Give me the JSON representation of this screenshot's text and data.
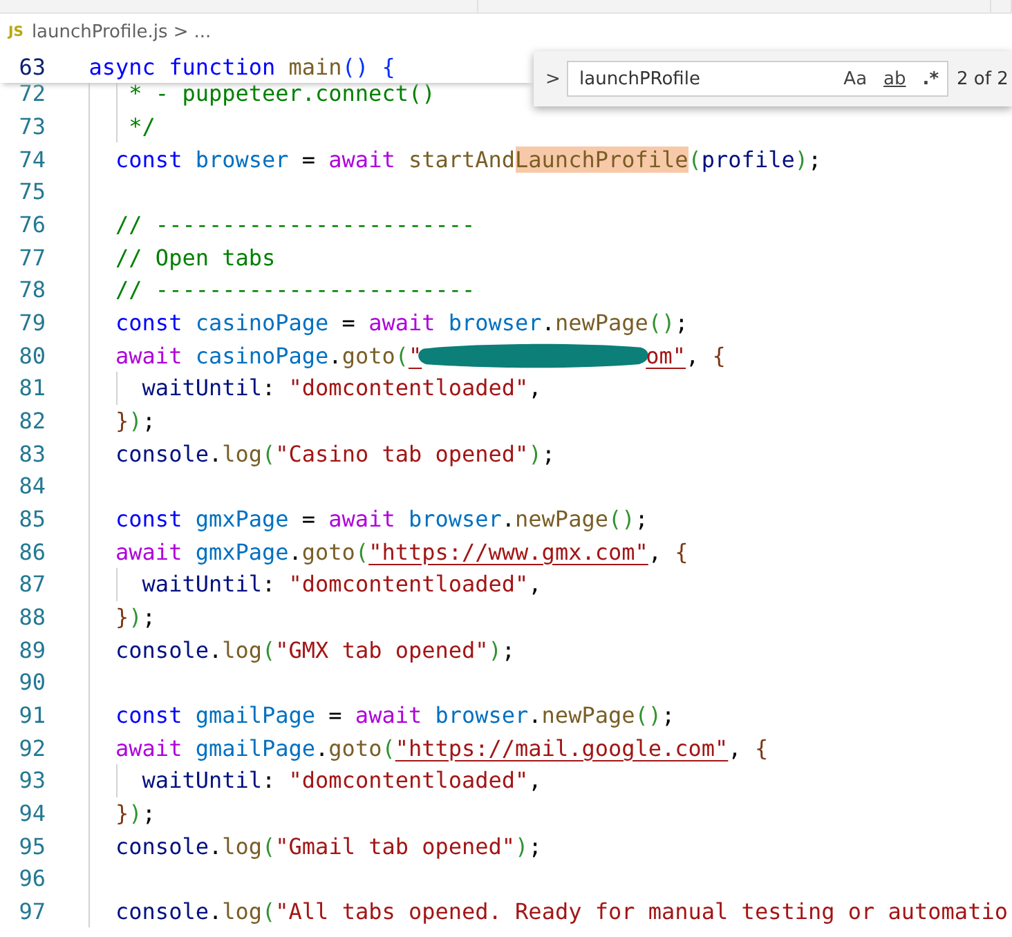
{
  "breadcrumb": {
    "file_badge": "JS",
    "file": "launchProfile.js",
    "separator": ">",
    "rest": "..."
  },
  "sticky_line": {
    "num": "63",
    "tokens": [
      {
        "kind": "kw",
        "text": "  async"
      },
      {
        "kind": "kw",
        "text": " function"
      },
      {
        "kind": "fn",
        "text": " main"
      },
      {
        "kind": "b1",
        "text": "()"
      },
      {
        "kind": "b1",
        "text": " {"
      }
    ]
  },
  "find_widget": {
    "toggle": ">",
    "query": "launchPRofile",
    "options": [
      {
        "label": "Aa",
        "on": false
      },
      {
        "label": "ab",
        "on": false
      },
      {
        "label": ".*",
        "on": false
      }
    ],
    "count": "2 of 2"
  },
  "lines": [
    {
      "num": "72",
      "tokens": [
        {
          "kind": "com",
          "text": "     * - puppeteer.connect()"
        }
      ]
    },
    {
      "num": "73",
      "tokens": [
        {
          "kind": "com",
          "text": "     */"
        }
      ]
    },
    {
      "num": "74",
      "tokens": [
        {
          "kind": "kw",
          "text": "    const"
        },
        {
          "kind": "cvar",
          "text": " browser"
        },
        {
          "kind": "plain",
          "text": " ="
        },
        {
          "kind": "ctrl",
          "text": " await"
        },
        {
          "kind": "fn",
          "text": " startAnd"
        },
        {
          "kind": "match",
          "text": "LaunchProfile"
        },
        {
          "kind": "b2",
          "text": "("
        },
        {
          "kind": "var",
          "text": "profile"
        },
        {
          "kind": "b2",
          "text": ")"
        },
        {
          "kind": "plain",
          "text": ";"
        }
      ]
    },
    {
      "num": "75"
    },
    {
      "num": "76",
      "tokens": [
        {
          "kind": "com",
          "text": "    // ------------------------"
        }
      ]
    },
    {
      "num": "77",
      "tokens": [
        {
          "kind": "com",
          "text": "    // Open tabs"
        }
      ]
    },
    {
      "num": "78",
      "tokens": [
        {
          "kind": "com",
          "text": "    // ------------------------"
        }
      ]
    },
    {
      "num": "79",
      "tokens": [
        {
          "kind": "kw",
          "text": "    const"
        },
        {
          "kind": "cvar",
          "text": " casinoPage"
        },
        {
          "kind": "plain",
          "text": " ="
        },
        {
          "kind": "ctrl",
          "text": " await"
        },
        {
          "kind": "cvar",
          "text": " browser"
        },
        {
          "kind": "plain",
          "text": "."
        },
        {
          "kind": "fn",
          "text": "newPage"
        },
        {
          "kind": "b2",
          "text": "()"
        },
        {
          "kind": "plain",
          "text": ";"
        }
      ]
    },
    {
      "num": "80",
      "tokens": [
        {
          "kind": "ctrl",
          "text": "    await"
        },
        {
          "kind": "cvar",
          "text": " casinoPage"
        },
        {
          "kind": "plain",
          "text": "."
        },
        {
          "kind": "fn",
          "text": "goto"
        },
        {
          "kind": "b2",
          "text": "("
        },
        {
          "kind": "url",
          "text": "\""
        },
        {
          "kind": "redacted"
        },
        {
          "kind": "url",
          "text": "om\""
        },
        {
          "kind": "plain",
          "text": ","
        },
        {
          "kind": "b3",
          "text": " {"
        }
      ]
    },
    {
      "num": "81",
      "tokens": [
        {
          "kind": "var",
          "text": "      waitUntil"
        },
        {
          "kind": "plain",
          "text": ":"
        },
        {
          "kind": "str",
          "text": " \"domcontentloaded\""
        },
        {
          "kind": "plain",
          "text": ","
        }
      ]
    },
    {
      "num": "82",
      "tokens": [
        {
          "kind": "b3",
          "text": "    }"
        },
        {
          "kind": "b2",
          "text": ")"
        },
        {
          "kind": "plain",
          "text": ";"
        }
      ]
    },
    {
      "num": "83",
      "tokens": [
        {
          "kind": "var",
          "text": "    console"
        },
        {
          "kind": "plain",
          "text": "."
        },
        {
          "kind": "fn",
          "text": "log"
        },
        {
          "kind": "b2",
          "text": "("
        },
        {
          "kind": "str",
          "text": "\"Casino tab opened\""
        },
        {
          "kind": "b2",
          "text": ")"
        },
        {
          "kind": "plain",
          "text": ";"
        }
      ]
    },
    {
      "num": "84"
    },
    {
      "num": "85",
      "tokens": [
        {
          "kind": "kw",
          "text": "    const"
        },
        {
          "kind": "cvar",
          "text": " gmxPage"
        },
        {
          "kind": "plain",
          "text": " ="
        },
        {
          "kind": "ctrl",
          "text": " await"
        },
        {
          "kind": "cvar",
          "text": " browser"
        },
        {
          "kind": "plain",
          "text": "."
        },
        {
          "kind": "fn",
          "text": "newPage"
        },
        {
          "kind": "b2",
          "text": "()"
        },
        {
          "kind": "plain",
          "text": ";"
        }
      ]
    },
    {
      "num": "86",
      "tokens": [
        {
          "kind": "ctrl",
          "text": "    await"
        },
        {
          "kind": "cvar",
          "text": " gmxPage"
        },
        {
          "kind": "plain",
          "text": "."
        },
        {
          "kind": "fn",
          "text": "goto"
        },
        {
          "kind": "b2",
          "text": "("
        },
        {
          "kind": "url",
          "text": "\"https://www.gmx.com\""
        },
        {
          "kind": "plain",
          "text": ","
        },
        {
          "kind": "b3",
          "text": " {"
        }
      ]
    },
    {
      "num": "87",
      "tokens": [
        {
          "kind": "var",
          "text": "      waitUntil"
        },
        {
          "kind": "plain",
          "text": ":"
        },
        {
          "kind": "str",
          "text": " \"domcontentloaded\""
        },
        {
          "kind": "plain",
          "text": ","
        }
      ]
    },
    {
      "num": "88",
      "tokens": [
        {
          "kind": "b3",
          "text": "    }"
        },
        {
          "kind": "b2",
          "text": ")"
        },
        {
          "kind": "plain",
          "text": ";"
        }
      ]
    },
    {
      "num": "89",
      "tokens": [
        {
          "kind": "var",
          "text": "    console"
        },
        {
          "kind": "plain",
          "text": "."
        },
        {
          "kind": "fn",
          "text": "log"
        },
        {
          "kind": "b2",
          "text": "("
        },
        {
          "kind": "str",
          "text": "\"GMX tab opened\""
        },
        {
          "kind": "b2",
          "text": ")"
        },
        {
          "kind": "plain",
          "text": ";"
        }
      ]
    },
    {
      "num": "90"
    },
    {
      "num": "91",
      "tokens": [
        {
          "kind": "kw",
          "text": "    const"
        },
        {
          "kind": "cvar",
          "text": " gmailPage"
        },
        {
          "kind": "plain",
          "text": " ="
        },
        {
          "kind": "ctrl",
          "text": " await"
        },
        {
          "kind": "cvar",
          "text": " browser"
        },
        {
          "kind": "plain",
          "text": "."
        },
        {
          "kind": "fn",
          "text": "newPage"
        },
        {
          "kind": "b2",
          "text": "()"
        },
        {
          "kind": "plain",
          "text": ";"
        }
      ]
    },
    {
      "num": "92",
      "tokens": [
        {
          "kind": "ctrl",
          "text": "    await"
        },
        {
          "kind": "cvar",
          "text": " gmailPage"
        },
        {
          "kind": "plain",
          "text": "."
        },
        {
          "kind": "fn",
          "text": "goto"
        },
        {
          "kind": "b2",
          "text": "("
        },
        {
          "kind": "url",
          "text": "\"https://mail.google.com\""
        },
        {
          "kind": "plain",
          "text": ","
        },
        {
          "kind": "b3",
          "text": " {"
        }
      ]
    },
    {
      "num": "93",
      "tokens": [
        {
          "kind": "var",
          "text": "      waitUntil"
        },
        {
          "kind": "plain",
          "text": ":"
        },
        {
          "kind": "str",
          "text": " \"domcontentloaded\""
        },
        {
          "kind": "plain",
          "text": ","
        }
      ]
    },
    {
      "num": "94",
      "tokens": [
        {
          "kind": "b3",
          "text": "    }"
        },
        {
          "kind": "b2",
          "text": ")"
        },
        {
          "kind": "plain",
          "text": ";"
        }
      ]
    },
    {
      "num": "95",
      "tokens": [
        {
          "kind": "var",
          "text": "    console"
        },
        {
          "kind": "plain",
          "text": "."
        },
        {
          "kind": "fn",
          "text": "log"
        },
        {
          "kind": "b2",
          "text": "("
        },
        {
          "kind": "str",
          "text": "\"Gmail tab opened\""
        },
        {
          "kind": "b2",
          "text": ")"
        },
        {
          "kind": "plain",
          "text": ";"
        }
      ]
    },
    {
      "num": "96"
    },
    {
      "num": "97",
      "tokens": [
        {
          "kind": "var",
          "text": "    console"
        },
        {
          "kind": "plain",
          "text": "."
        },
        {
          "kind": "fn",
          "text": "log"
        },
        {
          "kind": "b2",
          "text": "("
        },
        {
          "kind": "str",
          "text": "\"All tabs opened. Ready for manual testing or automatio"
        }
      ]
    }
  ]
}
